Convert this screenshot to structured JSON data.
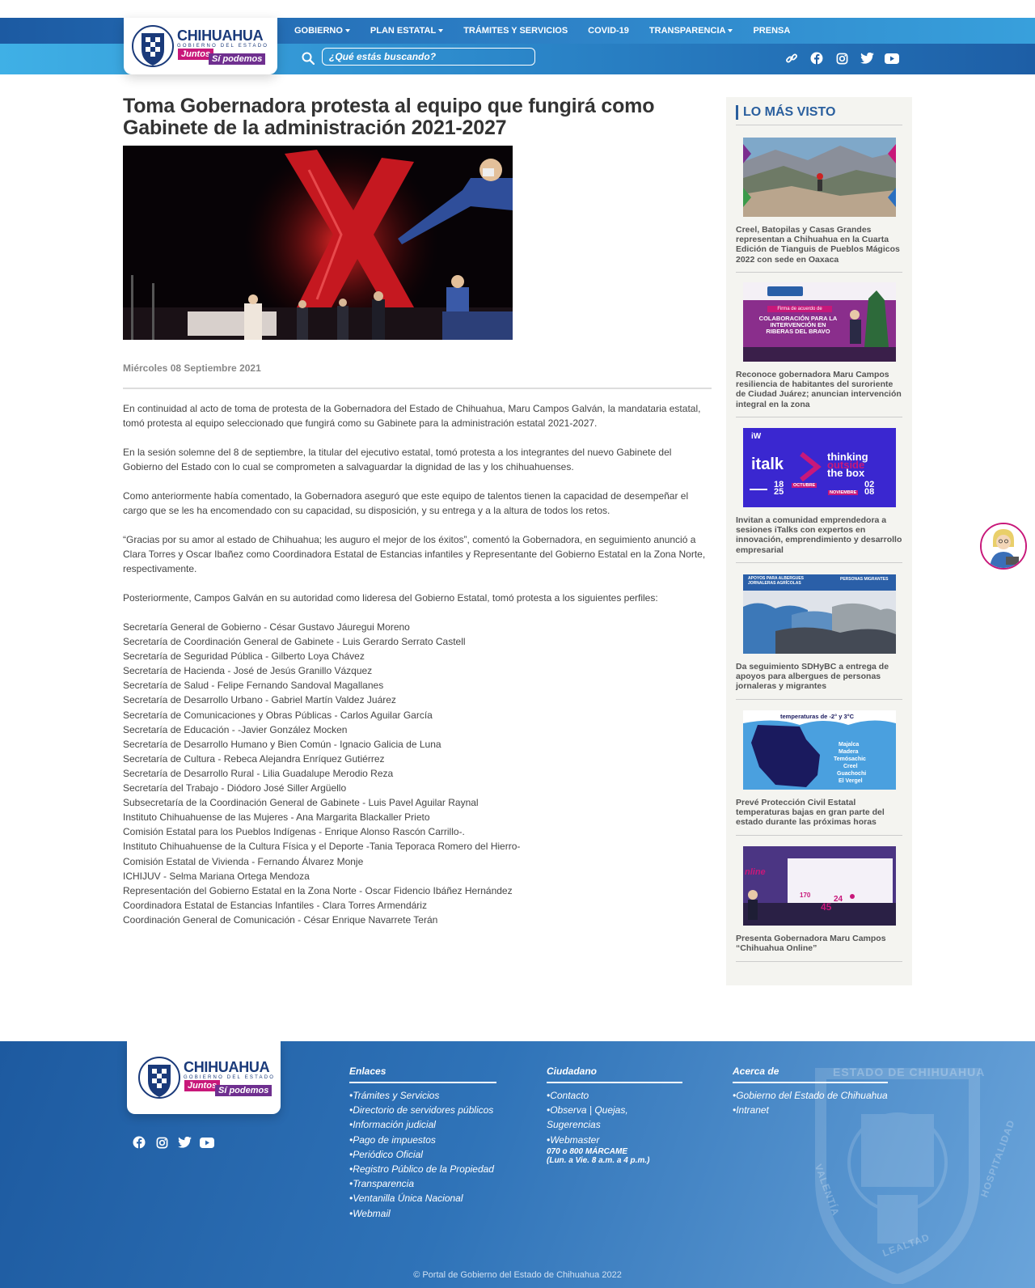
{
  "header": {
    "logo": {
      "title": "CHIHUAHUA",
      "subtitle": "GOBIERNO DEL ESTADO",
      "tag1": "Juntos",
      "tag2": "Sí podemos"
    },
    "nav": [
      {
        "label": "GOBIERNO",
        "dropdown": true
      },
      {
        "label": "PLAN ESTATAL",
        "dropdown": true
      },
      {
        "label": "TRÁMITES Y SERVICIOS",
        "dropdown": false
      },
      {
        "label": "COVID-19",
        "dropdown": false
      },
      {
        "label": "TRANSPARENCIA",
        "dropdown": true
      },
      {
        "label": "PRENSA",
        "dropdown": false
      }
    ],
    "search": {
      "placeholder": "¿Qué estás buscando?"
    },
    "social_icons": [
      "link-icon",
      "facebook-icon",
      "instagram-icon",
      "twitter-icon",
      "youtube-icon"
    ]
  },
  "article": {
    "title": "Toma Gobernadora protesta al equipo que fungirá como Gabinete de la administración 2021-2027",
    "date": "Miércoles 08 Septiembre 2021",
    "paragraphs": [
      "En continuidad al acto de toma de protesta de la Gobernadora del Estado de Chihuahua, Maru Campos Galván, la mandataria estatal, tomó protesta al equipo seleccionado que fungirá como su Gabinete para la administración estatal 2021-2027.",
      "En la sesión solemne del 8 de septiembre, la titular del ejecutivo estatal, tomó protesta a los integrantes del nuevo Gabinete del Gobierno del Estado con lo cual se comprometen a salvaguardar la dignidad de las y los chihuahuenses.",
      "Como anteriormente había comentado, la Gobernadora aseguró que este equipo de talentos tienen la capacidad de desempeñar el cargo que se les ha encomendado con su capacidad, su disposición, y su entrega y a la altura de todos los retos.",
      "“Gracias por su amor al estado de Chihuahua; les auguro el mejor de los éxitos”, comentó la Gobernadora, en seguimiento anunció a Clara Torres y Oscar Ibañez como Coordinadora Estatal de Estancias infantiles y Representante del Gobierno Estatal en la Zona Norte, respectivamente.",
      "Posteriormente, Campos Galván en su autoridad como lideresa del Gobierno Estatal, tomó protesta a los siguientes perfiles:"
    ],
    "roles": [
      "Secretaría General de Gobierno - César Gustavo Jáuregui Moreno",
      "Secretaría de Coordinación General de Gabinete - Luis Gerardo Serrato Castell",
      "Secretaría de Seguridad Pública - Gilberto Loya Chávez",
      "Secretaría de Hacienda - José de Jesús Granillo Vázquez",
      "Secretaría de Salud - Felipe Fernando Sandoval Magallanes",
      "Secretaría de Desarrollo Urbano - Gabriel Martín Valdez Juárez",
      "Secretaría de Comunicaciones y Obras Públicas - Carlos Aguilar García",
      "Secretaría de Educación - -Javier González Mocken",
      "Secretaría de Desarrollo Humano y Bien Común - Ignacio Galicia de Luna",
      "Secretaría de Cultura - Rebeca Alejandra Enríquez Gutiérrez",
      "Secretaría de Desarrollo Rural - Lilia Guadalupe Merodio Reza",
      "Secretaría del Trabajo - Diódoro José Siller Argüello",
      "Subsecretaría de la Coordinación General de Gabinete - Luis Pavel Aguilar Raynal",
      "Instituto Chihuahuense de las Mujeres - Ana Margarita Blackaller Prieto",
      "Comisión Estatal para los Pueblos Indígenas - Enrique Alonso Rascón Carrillo-.",
      "Instituto Chihuahuense de la Cultura Física y el Deporte -Tania Teporaca Romero del Hierro-",
      "Comisión Estatal de Vivienda - Fernando Álvarez Monje",
      "ICHIJUV - Selma Mariana Ortega Mendoza",
      "Representación del Gobierno Estatal en la Zona Norte - Oscar Fidencio Ibáñez Hernández",
      "Coordinadora Estatal de Estancias Infantiles - Clara Torres Armendáriz",
      "Coordinación General de Comunicación - César Enrique Navarrete Terán"
    ]
  },
  "sidebar": {
    "heading": "LO MÁS VISTO",
    "items": [
      {
        "caption": "Creel, Batopilas y Casas Grandes representan a Chihuahua en la Cuarta Edición de Tianguis de Pueblos Mágicos 2022 con sede en Oaxaca"
      },
      {
        "caption": "Reconoce gobernadora Maru Campos resiliencia de habitantes del suroriente de Ciudad Juárez; anuncian intervención integral en la zona",
        "thumb_text": [
          "Firma de acuerdo de",
          "COLABORACIÓN PARA LA INTERVENCIÓN EN RIBERAS DEL BRAVO"
        ]
      },
      {
        "caption": "Invitan a comunidad emprendedora a sesiones iTalks con expertos en innovación, emprendimiento y desarrollo empresarial",
        "thumb_text": [
          "iW",
          "italk",
          "thinking",
          "outside",
          "the box",
          "18",
          "25",
          "OCTUBRE",
          "NOVIEMBRE",
          "02",
          "08"
        ]
      },
      {
        "caption": "Da seguimiento SDHyBC a entrega de apoyos para albergues de personas jornaleras y migrantes",
        "thumb_text": [
          "APOYOS PARA ALBERGUES JORNALERAS AGRÍCOLAS",
          "PERSONAS MIGRANTES"
        ]
      },
      {
        "caption": "Prevé Protección Civil Estatal temperaturas bajas en gran parte del estado durante las próximas horas",
        "thumb_text": [
          "temperaturas de -2° y 3°C",
          "Majalca",
          "Madera",
          "Temósachic",
          "Creel",
          "Guachochi",
          "El Vergel"
        ]
      },
      {
        "caption": "Presenta Gobernadora Maru Campos “Chihuahua Online”",
        "thumb_text": [
          "nline",
          "170",
          "24",
          "45"
        ]
      }
    ]
  },
  "footer": {
    "logo": {
      "title": "CHIHUAHUA",
      "subtitle": "GOBIERNO DEL ESTADO",
      "tag1": "Juntos",
      "tag2": "Sí podemos"
    },
    "social_icons": [
      "facebook-icon",
      "instagram-icon",
      "twitter-icon",
      "youtube-icon"
    ],
    "enlaces": {
      "title": "Enlaces",
      "links": [
        "•Trámites y Servicios",
        "•Directorio de servidores públicos",
        "•Información judicial",
        "•Pago de impuestos",
        "•Periódico Oficial",
        "•Registro Público de la Propiedad",
        "•Transparencia",
        "•Ventanilla Única Nacional",
        "•Webmail"
      ]
    },
    "ciudadano": {
      "title": "Ciudadano",
      "links": [
        "•Contacto",
        "•Observa | Quejas, Sugerencias",
        "•Webmaster"
      ],
      "phone": "070 o 800 MÁRCAME",
      "hours": "(Lun. a Vie. 8 a.m. a 4 p.m.)"
    },
    "acerca": {
      "title": "Acerca de",
      "links": [
        "•Gobierno del Estado de Chihuahua",
        "•Intranet"
      ]
    },
    "watermark_text": [
      "ESTADO DE CHIHUAHUA",
      "VALENTÍA",
      "LEALTAD",
      "HOSPITALIDAD"
    ],
    "copyright": "© Portal de Gobierno del Estado de Chihuahua 2022"
  },
  "colors": {
    "primary": "#1c5aa2",
    "accent_light": "#3fb0e6",
    "tag_pink": "#c8187a",
    "tag_purple": "#6f2f8f"
  }
}
